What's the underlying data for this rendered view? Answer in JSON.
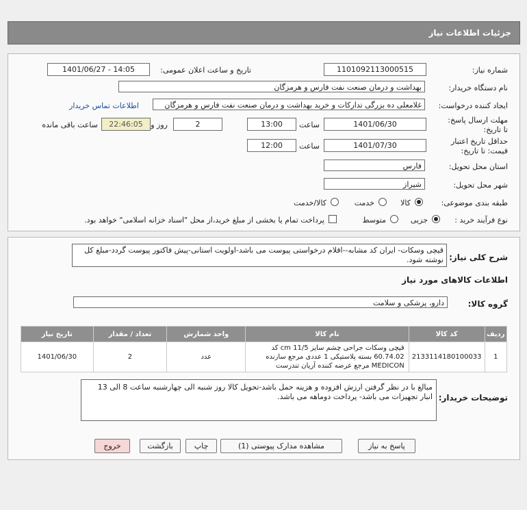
{
  "header": {
    "title": "جزئیات اطلاعات نیاز"
  },
  "form": {
    "need_number_label": "شماره نیاز:",
    "need_number": "1101092113000515",
    "announce_label": "تاریخ و ساعت اعلان عمومی:",
    "announce_value": "1401/06/27 - 14:05",
    "buyer_org_label": "نام دستگاه خریدار:",
    "buyer_org": "بهداشت و درمان صنعت نفت فارس و هرمزگان",
    "creator_label": "ایجاد کننده درخواست:",
    "creator": "غلامعلی ده بزرگی تدارکات و خرید بهداشت و درمان صنعت نفت فارس و هرمزگان",
    "contact_link": "اطلاعات تماس خریدار",
    "reply_deadline_label": "مهلت ارسال پاسخ: تا تاریخ:",
    "reply_date": "1401/06/30",
    "time_label": "ساعت",
    "reply_time": "13:00",
    "days_value": "2",
    "days_and_label": "روز و",
    "remaining_time": "22:46:05",
    "remaining_label": "ساعت باقی مانده",
    "validity_label": "حداقل تاریخ اعتبار قیمت: تا تاریخ:",
    "validity_date": "1401/07/30",
    "validity_time": "12:00",
    "province_label": "استان محل تحویل:",
    "province": "فارس",
    "city_label": "شهر محل تحویل:",
    "city": "شیراز",
    "category_label": "طبقه بندی موضوعی:",
    "category_options": [
      "کالا",
      "خدمت",
      "کالا/خدمت"
    ],
    "process_label": "نوع فرآیند خرید :",
    "process_options": [
      "جزیی",
      "متوسط"
    ],
    "payment_note": "پرداخت تمام یا بخشی از مبلغ خرید،از محل \"اسناد خزانه اسلامی\" خواهد بود."
  },
  "summary": {
    "label": "شرح کلی نیاز:",
    "text": "قیچی وسکات- ایران کد مشابه--اقلام درخواستی پیوست می باشد-اولویت استانی-پیش فاکتور پیوست گردد-مبلغ کل نوشته شود."
  },
  "goods": {
    "section_title": "اطلاعات کالاهای مورد نیاز",
    "group_label": "گروه کالا:",
    "group_value": "دارو، پزشکی و سلامت",
    "columns": [
      "ردیف",
      "کد کالا",
      "نام کالا",
      "واحد شمارش",
      "تعداد / مقدار",
      "تاریخ نیاز"
    ],
    "rows": [
      {
        "row": "1",
        "code": "2133114180100033",
        "name": "قیچی وسکات جراحی چشم سایز cm 11/5 کد 60.74.02 بسته پلاستیکی 1 عددی مرجع سازنده MEDICON مرجع عرضه کننده آریان تندرست",
        "unit": "عدد",
        "qty": "2",
        "date": "1401/06/30"
      }
    ]
  },
  "buyer_notes": {
    "label": "توضیحات خریدار:",
    "text": "مبالغ با در نظر گرفتن ارزش افزوده و هزینه حمل باشد-تحویل کالا روز شنبه الی چهارشنبه ساعت 8 الی 13 انبار تجهیزات می باشد- پرداخت دوماهه می باشد."
  },
  "buttons": {
    "reply": "پاسخ به نیاز",
    "attachments": "مشاهده مدارک پیوستی (1)",
    "print": "چاپ",
    "back": "بازگشت",
    "exit": "خروج"
  },
  "watermark": {
    "text": "ParsNamadData"
  }
}
